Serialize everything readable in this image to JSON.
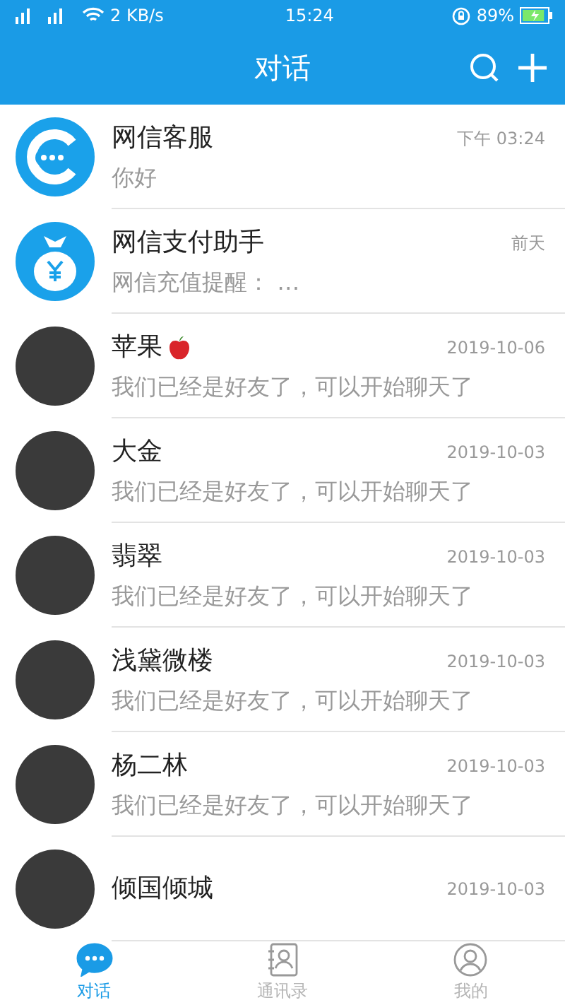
{
  "status_bar": {
    "speed": "2 KB/s",
    "time": "15:24",
    "battery": "89%",
    "charging": true
  },
  "header": {
    "title": "对话"
  },
  "conversations": [
    {
      "kind": "service",
      "name": "网信客服",
      "time": "下午 03:24",
      "preview": "你好"
    },
    {
      "kind": "payment",
      "name": "网信支付助手",
      "time": "前天",
      "preview": "网信充值提醒：  …"
    },
    {
      "kind": "photo",
      "name": "苹果",
      "apple": true,
      "time": "2019-10-06",
      "preview": "我们已经是好友了，可以开始聊天了"
    },
    {
      "kind": "photo",
      "name": "大金",
      "apple": false,
      "time": "2019-10-03",
      "preview": "我们已经是好友了，可以开始聊天了"
    },
    {
      "kind": "photo",
      "name": "翡翠",
      "apple": false,
      "time": "2019-10-03",
      "preview": "我们已经是好友了，可以开始聊天了"
    },
    {
      "kind": "photo",
      "name": "浅黛微楼",
      "apple": false,
      "time": "2019-10-03",
      "preview": "我们已经是好友了，可以开始聊天了"
    },
    {
      "kind": "photo",
      "name": "杨二林",
      "apple": false,
      "time": "2019-10-03",
      "preview": "我们已经是好友了，可以开始聊天了"
    },
    {
      "kind": "photo",
      "name": "倾国倾城",
      "apple": false,
      "time": "2019-10-03"
    }
  ],
  "tabs": [
    {
      "label": "对话",
      "selected": true
    },
    {
      "label": "通讯录",
      "selected": false
    },
    {
      "label": "我的",
      "selected": false
    }
  ]
}
